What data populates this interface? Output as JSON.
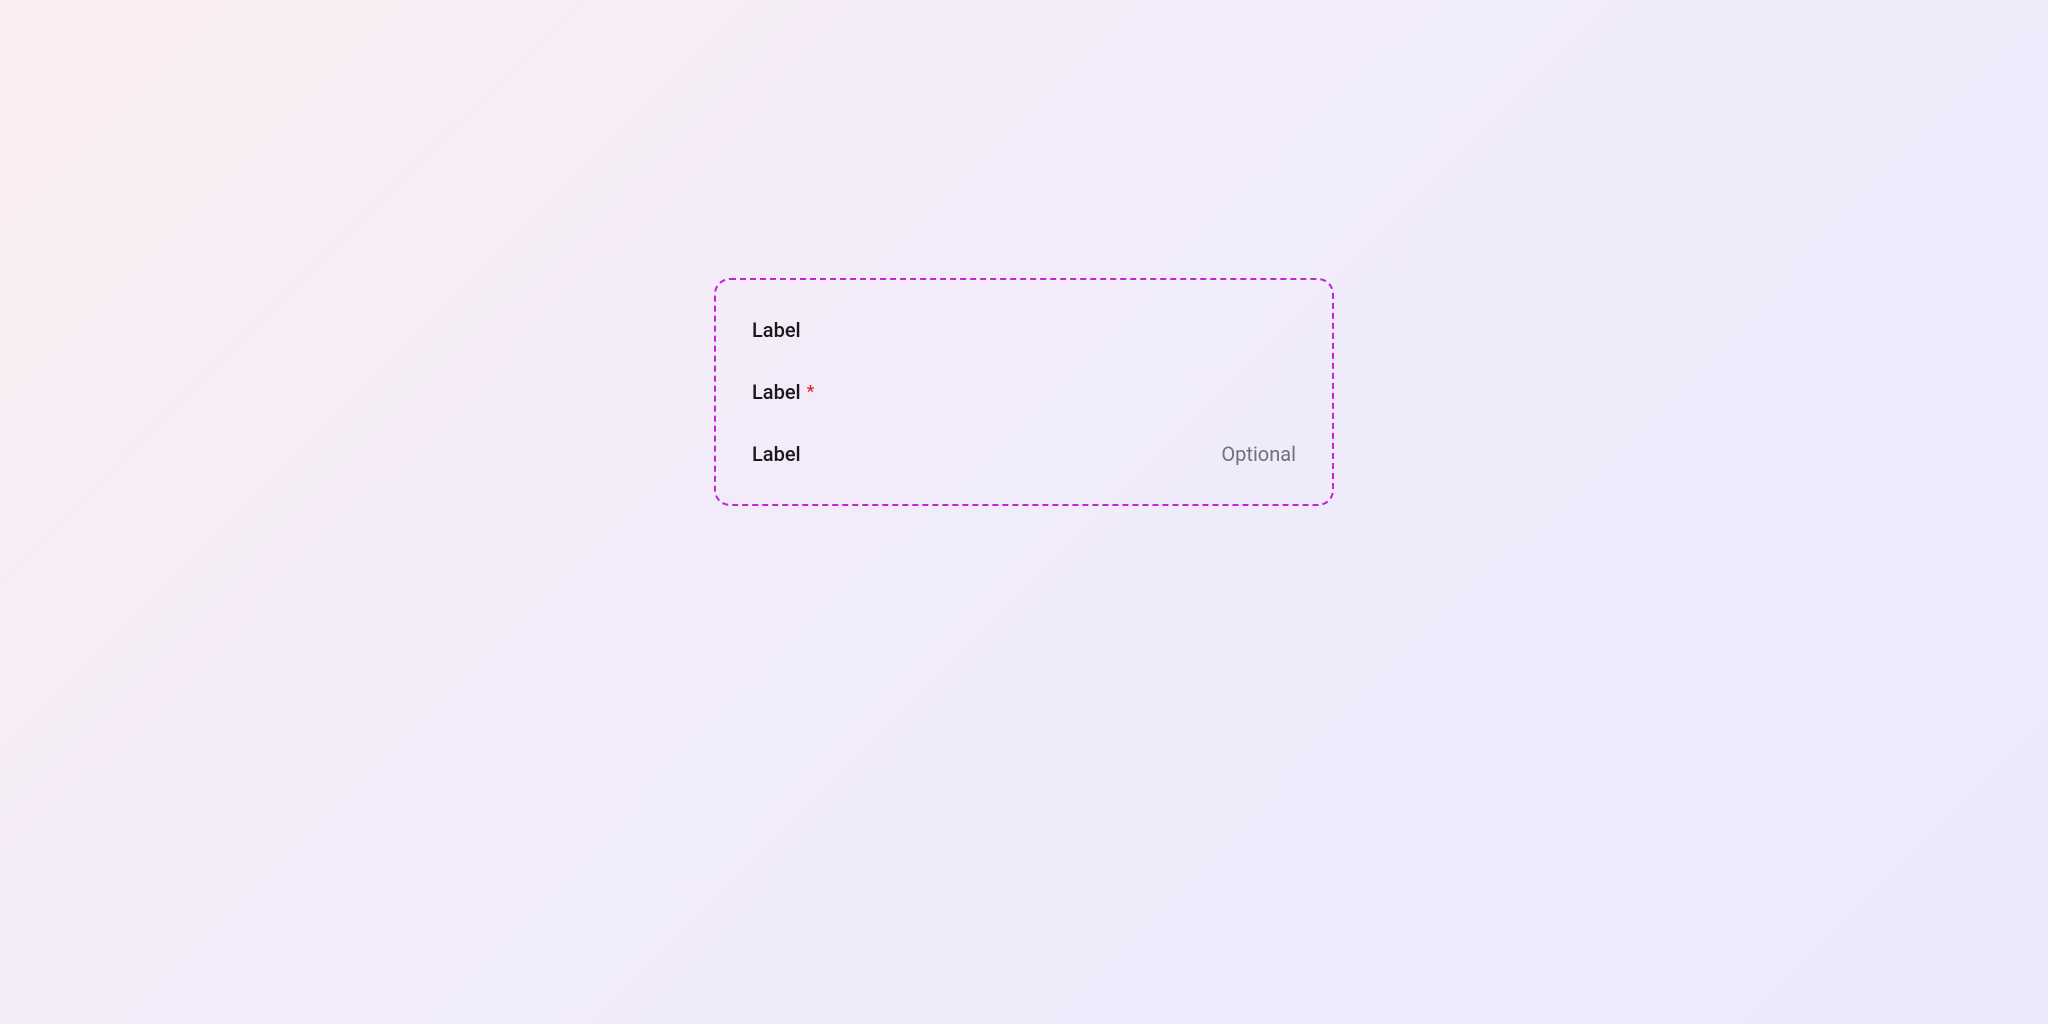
{
  "labels": {
    "0": {
      "text": "Label"
    },
    "1": {
      "text": "Label",
      "asterisk": "*"
    },
    "2": {
      "text": "Label",
      "suffix": "Optional"
    }
  }
}
